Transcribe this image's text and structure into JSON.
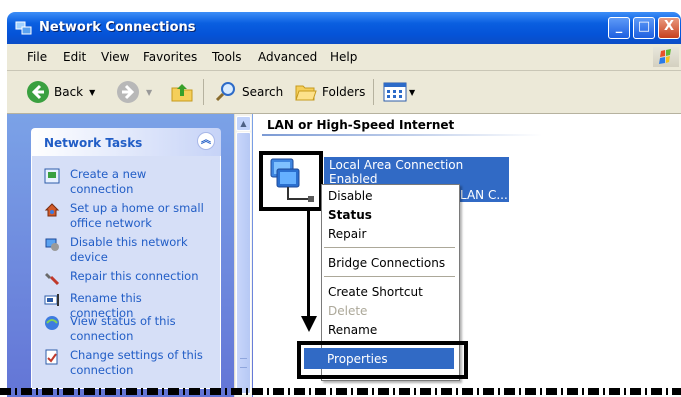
{
  "window": {
    "title": "Network Connections",
    "controls": {
      "minimize": "_",
      "maximize": "□",
      "close": "X"
    }
  },
  "menu": [
    "File",
    "Edit",
    "View",
    "Favorites",
    "Tools",
    "Advanced",
    "Help"
  ],
  "toolbar": {
    "back_label": "Back",
    "search_label": "Search",
    "folders_label": "Folders"
  },
  "network_tasks": {
    "header": "Network Tasks",
    "items": [
      {
        "label": "Create a new connection",
        "icon": "new-connection-icon"
      },
      {
        "label": "Set up a home or small office network",
        "icon": "home-network-icon"
      },
      {
        "label": "Disable this network device",
        "icon": "disable-network-icon"
      },
      {
        "label": "Repair this connection",
        "icon": "repair-icon"
      },
      {
        "label": "Rename this connection",
        "icon": "rename-icon"
      },
      {
        "label": "View status of this connection",
        "icon": "status-icon"
      },
      {
        "label": "Change settings of this connection",
        "icon": "settings-icon"
      }
    ]
  },
  "content": {
    "group_header": "LAN or High-Speed Internet",
    "connection": {
      "name": "Local Area Connection",
      "status": "Enabled",
      "type": "LAN C..."
    }
  },
  "context_menu": {
    "items": {
      "disable": "Disable",
      "status": "Status",
      "repair": "Repair",
      "bridge": "Bridge Connections",
      "create_shortcut": "Create Shortcut",
      "delete": "Delete",
      "rename": "Rename",
      "properties": "Properties"
    },
    "highlighted": "Properties"
  },
  "colors": {
    "titlebar": "#0553d8",
    "selection": "#316ac5",
    "task_link": "#215dc6",
    "pane_bg": "#6375d6"
  }
}
